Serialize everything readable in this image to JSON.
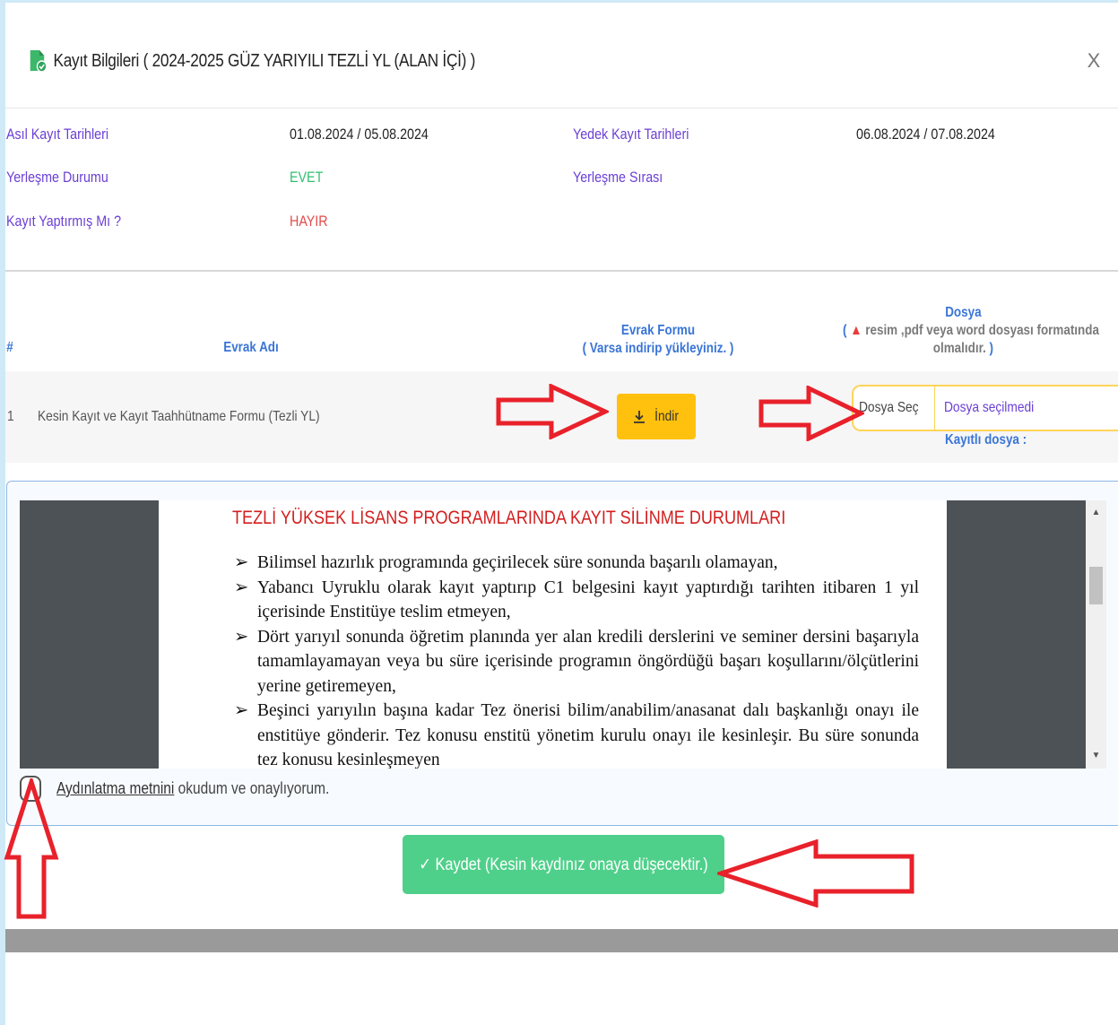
{
  "modal": {
    "title": "Kayıt Bilgileri ( 2024-2025 GÜZ YARIYILI TEZLİ YL (ALAN İÇİ) )",
    "close_label": "X"
  },
  "info": {
    "asil_label": "Asıl Kayıt Tarihleri",
    "asil_value": "01.08.2024 / 05.08.2024",
    "yedek_label": "Yedek Kayıt Tarihleri",
    "yedek_value": "06.08.2024 / 07.08.2024",
    "yerlesme_label": "Yerleşme Durumu",
    "yerlesme_value": "EVET",
    "sira_label": "Yerleşme Sırası",
    "kayit_label": "Kayıt Yaptırmış Mı ?",
    "kayit_value": "HAYIR"
  },
  "table": {
    "col_num": "#",
    "col_name": "Evrak Adı",
    "col_form_line1": "Evrak Formu",
    "col_form_line2": "( Varsa indirip yükleyiniz. )",
    "col_file_line1": "Dosya",
    "col_file_line2_prefix": "(",
    "col_file_line2": "resim ,pdf veya word dosyası formatında",
    "col_file_line3": "olmalıdır.",
    "col_file_line3_suffix": ")",
    "rows": [
      {
        "num": "1",
        "name": "Kesin Kayıt ve Kayıt Taahhütname Formu (Tezli YL)",
        "download_label": "İndir",
        "choose_label": "Dosya Seç",
        "no_file_label": "Dosya seçilmedi",
        "saved_file_label": "Kayıtlı dosya :"
      }
    ]
  },
  "document": {
    "title": "TEZLİ YÜKSEK LİSANS PROGRAMLARINDA KAYIT SİLİNME DURUMLARI",
    "bullet": "➢",
    "items": [
      "Bilimsel hazırlık programında geçirilecek süre sonunda başarılı olamayan,",
      "Yabancı Uyruklu olarak kayıt yaptırıp C1 belgesini kayıt yaptırdığı tarihten itibaren 1 yıl içerisinde Enstitüye teslim etmeyen,",
      "Dört yarıyıl sonunda öğretim planında yer alan kredili derslerini ve seminer dersini başarıyla tamamlayamayan veya bu süre içerisinde programın öngördüğü başarı koşullarını/ölçütlerini yerine getiremeyen,",
      "Beşinci yarıyılın başına kadar Tez önerisi bilim/anabilim/anasanat dalı başkanlığı onayı ile enstitüye gönderir. Tez konusu enstitü yönetim kurulu onayı ile kesinleşir. Bu süre sonunda tez konusu kesinleşmeyen"
    ]
  },
  "consent": {
    "link_text": "Aydınlatma metnini",
    "rest_text": " okudum ve onaylıyorum."
  },
  "save": {
    "label": "✓ Kaydet (Kesin kaydınız onaya düşecektir.)"
  },
  "colors": {
    "label_purple": "#6a3fd4",
    "accent_blue": "#3a75d6",
    "yes_green": "#2dbf6e",
    "no_red": "#e24b4b",
    "download_yellow": "#ffc10d",
    "save_green": "#4fd08a",
    "arrow_red": "#e8212b"
  }
}
